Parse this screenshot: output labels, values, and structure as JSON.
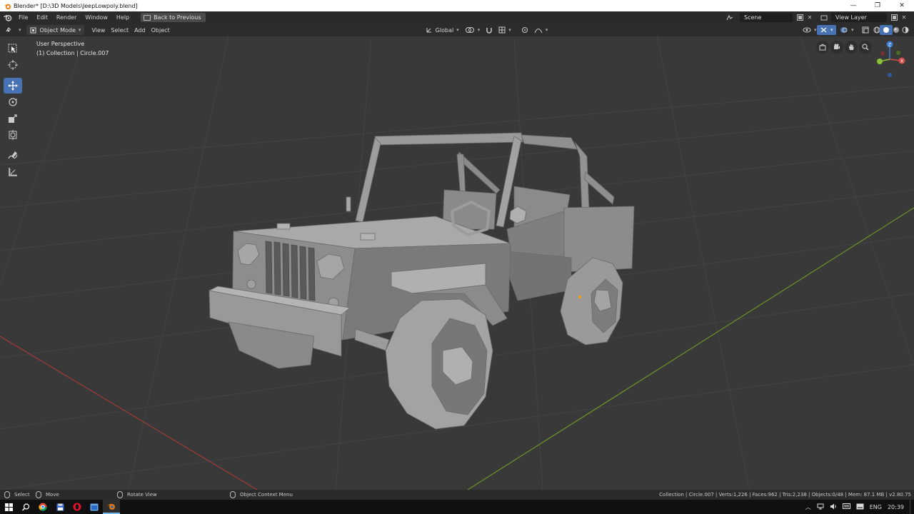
{
  "window": {
    "title": "Blender* [D:\\3D Models\\JeepLowpoly.blend]",
    "controls": {
      "minimize": "—",
      "maximize": "❐",
      "close": "✕"
    }
  },
  "topbar": {
    "menus": [
      "File",
      "Edit",
      "Render",
      "Window",
      "Help"
    ],
    "back_button": "Back to Previous",
    "scene": "Scene",
    "view_layer": "View Layer"
  },
  "viewport_header": {
    "mode": "Object Mode",
    "menus": [
      "View",
      "Select",
      "Add",
      "Object"
    ],
    "transform_orientation": "Global"
  },
  "viewport": {
    "perspective_label": "User Perspective",
    "collection_label": "(1) Collection | Circle.007"
  },
  "toolbar": {
    "tools": [
      "select-box",
      "cursor",
      "move",
      "rotate",
      "scale",
      "transform",
      "annotate",
      "measure"
    ],
    "active_tool": "move"
  },
  "gizmo": {
    "axes": [
      "X",
      "Y",
      "Z"
    ]
  },
  "statusbar": {
    "select": "Select",
    "move": "Move",
    "rotate_view": "Rotate View",
    "context_menu": "Object Context Menu",
    "stats": "Collection | Circle.007 | Verts:1,226 | Faces:962 | Tris:2,238 | Objects:0/48 | Mem: 87.1 MB | v2.80.75"
  },
  "taskbar": {
    "language": "ENG",
    "time": "20:39"
  },
  "colors": {
    "accent": "#4772b3",
    "x_axis": "#d34b4b",
    "y_axis": "#8cbf3a",
    "z_axis": "#3f7cd8"
  }
}
